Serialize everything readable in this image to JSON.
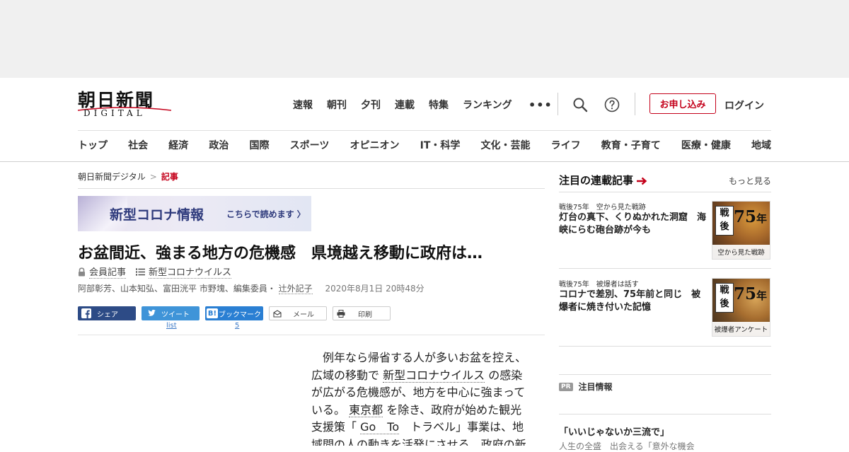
{
  "brand": {
    "logo_main": "朝日新聞",
    "logo_sub": "DIGITAL"
  },
  "header": {
    "top_nav": [
      "速報",
      "朝刊",
      "夕刊",
      "連載",
      "特集",
      "ランキング"
    ],
    "more": "•••",
    "subscribe": "お申し込み",
    "login": "ログイン",
    "category_nav": [
      "トップ",
      "社会",
      "経済",
      "政治",
      "国際",
      "スポーツ",
      "オピニオン",
      "IT・科学",
      "文化・芸能",
      "ライフ",
      "教育・子育て",
      "医療・健康",
      "地域"
    ]
  },
  "breadcrumb": {
    "home": "朝日新聞デジタル",
    "separator": ">",
    "current": "記事"
  },
  "banner": {
    "title": "新型コロナ情報",
    "link": "こちらで読めます"
  },
  "article": {
    "title": "お盆間近、強まる地方の危機感　県境越え移動に政府は…",
    "member_label": "会員記事",
    "topic": "新型コロナウイルス",
    "authors": "阿部彰芳、山本知弘、富田洸平 市野塊、編集委員・",
    "author_link": "辻外記子",
    "date": "2020年8月1日 20時48分",
    "body": {
      "t1": "例年なら帰省する人が多いお盆を控え、広域の移動で",
      "l1": "新型コロナウイルス",
      "t2": "の感染が広がる危機感が、地方を中心に強まっている。",
      "l2": "東京都",
      "t3": "を除き、政府が始めた観光支援策「",
      "l3": "Go　To",
      "t4": "　トラベル」事業は、地域間の人の動きを活発にさせる。政府の新"
    }
  },
  "share": {
    "facebook": "シェア",
    "twitter": "ツイート",
    "twitter_count": "list",
    "hatena": "ブックマーク",
    "hatena_count": "5",
    "mail": "メール",
    "print": "印刷"
  },
  "sidebar": {
    "heading": "注目の連載記事",
    "more": "もっと見る",
    "items": [
      {
        "category": "戦後75年　空から見た戦跡",
        "title": "灯台の真下、くりぬかれた洞窟　海峡にらむ砲台跡が今も",
        "thumb_kanji": "戦後",
        "thumb_num": "75",
        "thumb_unit": "年",
        "thumb_caption": "空から見た戦跡"
      },
      {
        "category": "戦後75年　被爆者は話す",
        "title": "コロナで差別、75年前と同じ　被爆者に焼き付いた記憶",
        "thumb_kanji": "戦後",
        "thumb_num": "75",
        "thumb_unit": "年",
        "thumb_caption": "被爆者アンケート"
      }
    ],
    "pr_badge": "PR",
    "pr_label": "注目情報",
    "promo_title": "「いいじゃないか三流で」",
    "promo_sub": "人生の全盛　出会える「意外な機会"
  },
  "colors": {
    "accent": "#c4001a",
    "facebook": "#2d4b86",
    "twitter": "#3f94d8",
    "hatena": "#2a7fd3",
    "banner_text": "#2e3a7c"
  }
}
